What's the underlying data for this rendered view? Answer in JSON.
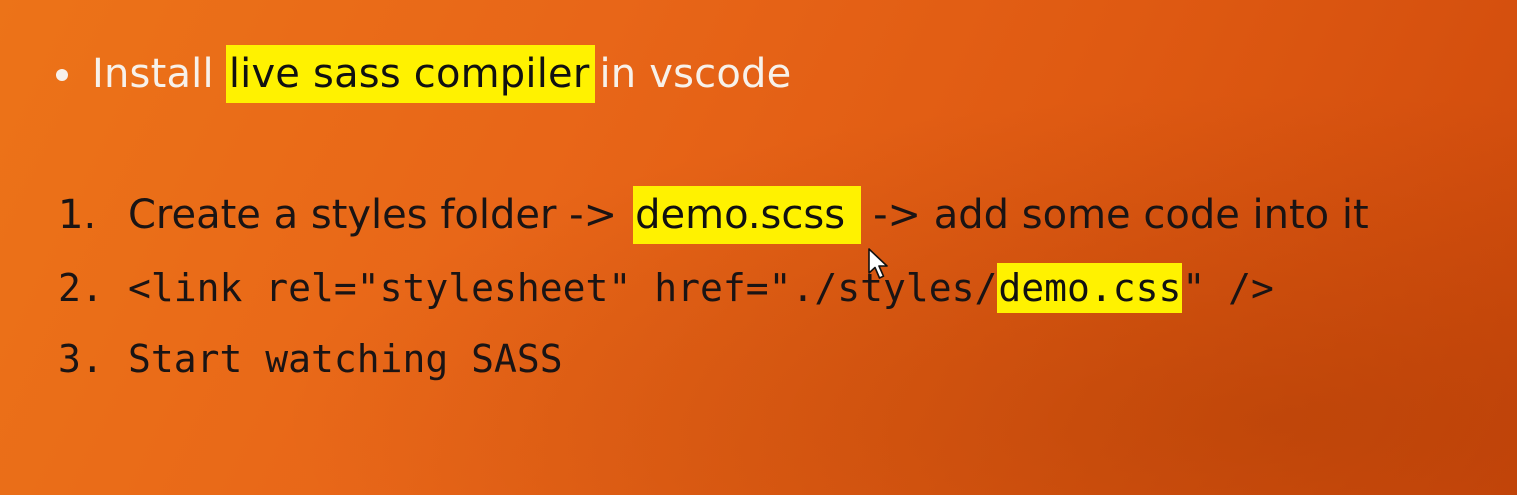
{
  "bullet": {
    "before": "Install",
    "highlight": "live sass compiler",
    "after": "in vscode"
  },
  "steps": [
    {
      "number": "1.",
      "before": "Create a styles folder ->",
      "highlight": "demo.scss",
      "after": "-> add some code into it"
    },
    {
      "number": "2.",
      "before": "<link rel=\"stylesheet\" href=\"./styles/",
      "highlight": "demo.css",
      "after": "\" />"
    },
    {
      "number": "3.",
      "text": "Start watching SASS"
    }
  ],
  "colors": {
    "background": "#e86618",
    "highlight": "#fff200",
    "bullet_text": "#f7f1ea",
    "step_text": "#1a1414"
  },
  "icons": {
    "bullet": "bullet-dot-icon",
    "cursor": "mouse-pointer-icon"
  }
}
